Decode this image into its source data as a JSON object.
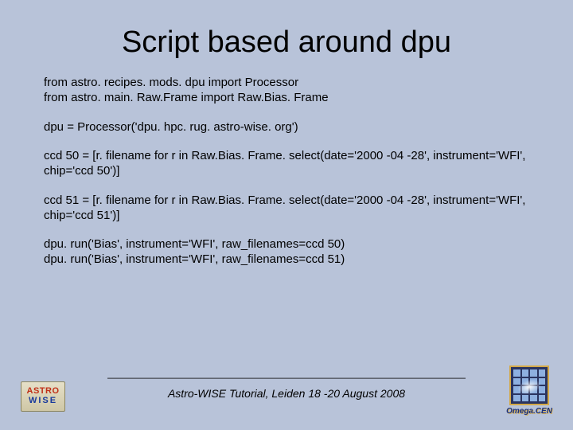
{
  "title": "Script based around dpu",
  "lines": {
    "l1": "from astro. recipes. mods. dpu import Processor",
    "l2": "from astro. main. Raw.Frame import Raw.Bias. Frame",
    "l3": "dpu = Processor('dpu. hpc. rug. astro-wise. org')",
    "l4": "ccd 50 = [r. filename for r in Raw.Bias. Frame. select(date='2000 -04 -28', instrument='WFI', chip='ccd 50')]",
    "l5": "ccd 51 = [r. filename for r in Raw.Bias. Frame. select(date='2000 -04 -28', instrument='WFI', chip='ccd 51')]",
    "l6": "dpu. run('Bias', instrument='WFI', raw_filenames=ccd 50)",
    "l7": "dpu. run('Bias', instrument='WFI', raw_filenames=ccd 51)"
  },
  "footer": "Astro-WISE Tutorial, Leiden 18 -20 August 2008",
  "logoLeft": {
    "line1": "ASTRO",
    "line2": "WISE"
  },
  "logoRight": {
    "label": "Omega.CEN"
  }
}
